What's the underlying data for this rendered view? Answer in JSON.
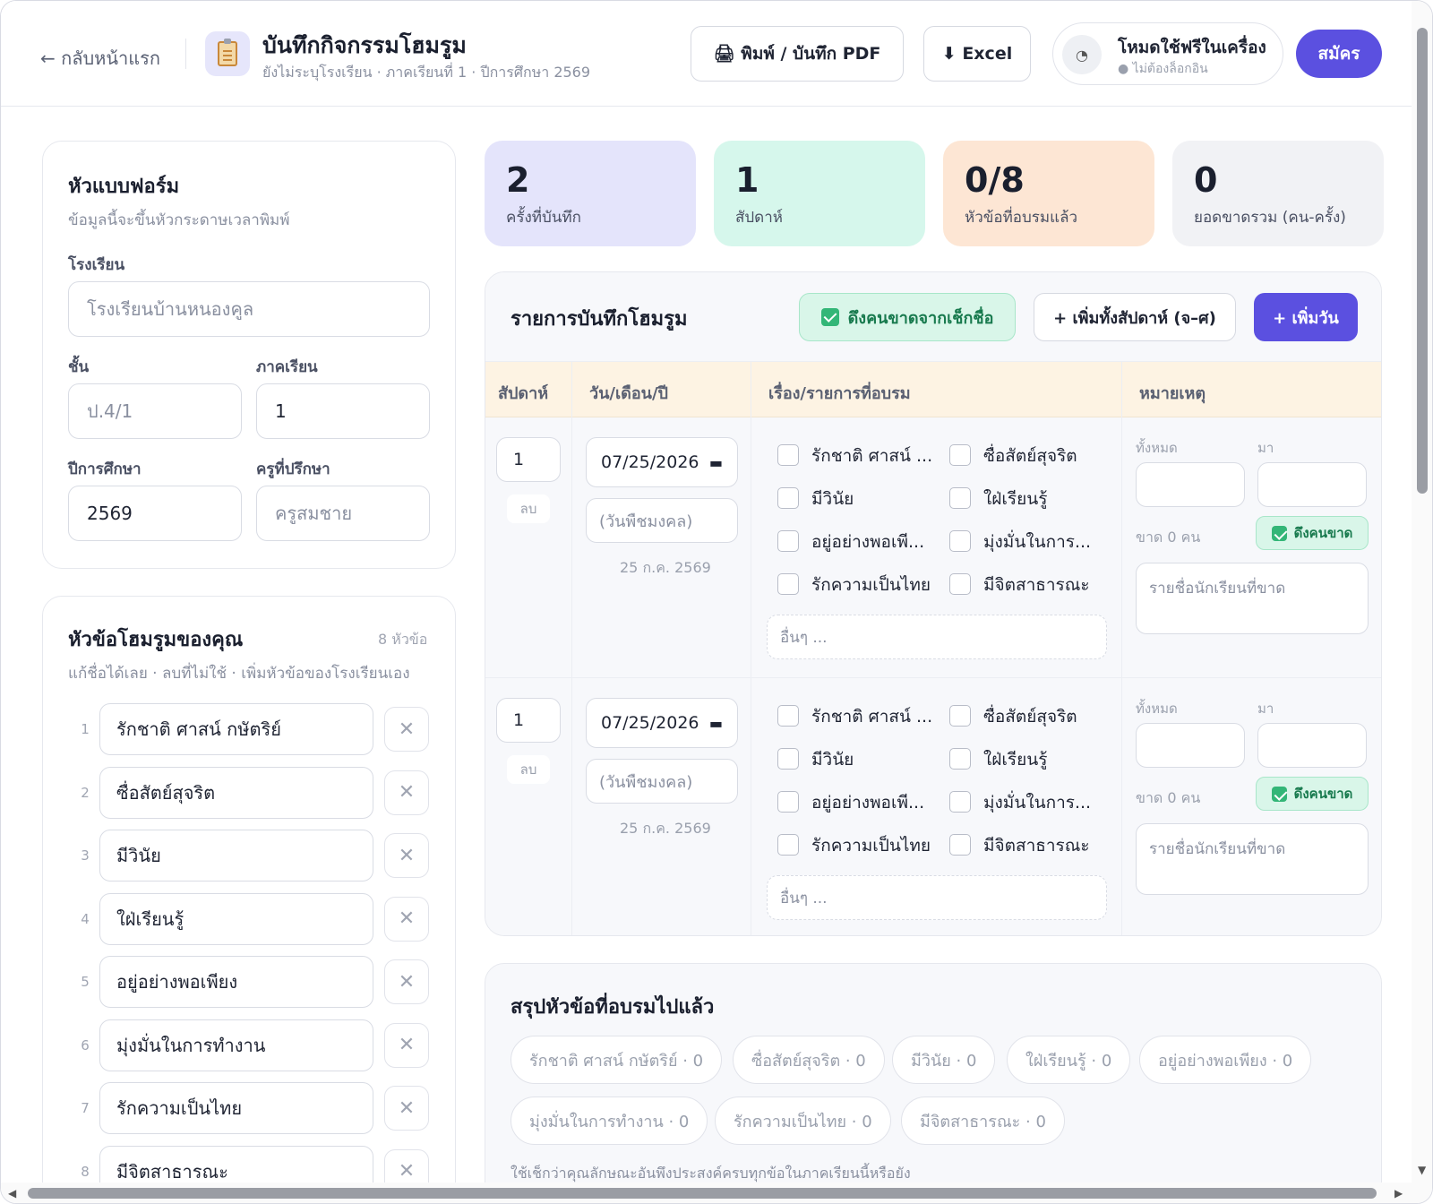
{
  "header": {
    "back_label": "← กลับหน้าแรก",
    "title": "บันทึกกิจกรรมโฮมรูม",
    "subtitle": "ยังไม่ระบุโรงเรียน · ภาคเรียนที่ 1 · ปีการศึกษา 2569",
    "print_label": "🖨 พิมพ์ / บันทึก PDF",
    "excel_label": "⬇ Excel",
    "mode_title": "โหมดใช้ฟรีในเครื่อง",
    "mode_sub": "● ไม่ต้องล็อกอิน",
    "signup_label": "สมัคร"
  },
  "form": {
    "title": "หัวแบบฟอร์ม",
    "desc": "ข้อมูลนี้จะขึ้นหัวกระดาษเวลาพิมพ์",
    "school_label": "โรงเรียน",
    "school_placeholder": "โรงเรียนบ้านหนองคูล",
    "class_label": "ชั้น",
    "class_placeholder": "ป.4/1",
    "term_label": "ภาคเรียน",
    "term_value": "1",
    "year_label": "ปีการศึกษา",
    "year_value": "2569",
    "teacher_label": "ครูที่ปรึกษา",
    "teacher_placeholder": "ครูสมชาย"
  },
  "topics": {
    "title": "หัวข้อโฮมรูมของคุณ",
    "count_label": "8 หัวข้อ",
    "desc": "แก้ชื่อได้เลย · ลบที่ไม่ใช้ · เพิ่มหัวข้อของโรงเรียนเอง",
    "items": [
      {
        "n": "1",
        "name": "รักชาติ ศาสน์ กษัตริย์"
      },
      {
        "n": "2",
        "name": "ซื่อสัตย์สุจริต"
      },
      {
        "n": "3",
        "name": "มีวินัย"
      },
      {
        "n": "4",
        "name": "ใฝ่เรียนรู้"
      },
      {
        "n": "5",
        "name": "อยู่อย่างพอเพียง"
      },
      {
        "n": "6",
        "name": "มุ่งมั่นในการทำงาน"
      },
      {
        "n": "7",
        "name": "รักความเป็นไทย"
      },
      {
        "n": "8",
        "name": "มีจิตสาธารณะ"
      }
    ]
  },
  "stats": [
    {
      "value": "2",
      "label": "ครั้งที่บันทึก",
      "color": "#e4e4fb"
    },
    {
      "value": "1",
      "label": "สัปดาห์",
      "color": "#d6f7ec"
    },
    {
      "value": "0/8",
      "label": "หัวข้อที่อบรมแล้ว",
      "color": "#fde6d4"
    },
    {
      "value": "0",
      "label": "ยอดขาดรวม (คน-ครั้ง)",
      "color": "#f1f2f5"
    }
  ],
  "records": {
    "title": "รายการบันทึกโฮมรูม",
    "pull_label": "ดึงคนขาดจากเช็กชื่อ",
    "add_week_label": "+ เพิ่มทั้งสัปดาห์ (จ–ศ)",
    "add_day_label": "+ เพิ่มวัน",
    "columns": [
      "สัปดาห์",
      "วัน/เดือน/ปี",
      "เรื่อง/รายการที่อบรม",
      "หมายเหตุ"
    ],
    "rows": [
      {
        "week": "1",
        "delete_label": "ลบ",
        "date": "07/25/2026",
        "day_name": "(วันพืชมงคล)",
        "thai_date": "25 ก.ค. 2569",
        "topics": [
          "รักชาติ ศาสน์ ...",
          "ซื่อสัตย์สุจริต",
          "มีวินัย",
          "ใฝ่เรียนรู้",
          "อยู่อย่างพอเพี...",
          "มุ่งมั่นในการ...",
          "รักความเป็นไทย",
          "มีจิตสาธารณะ"
        ],
        "other_placeholder": "อื่นๆ ...",
        "total_label": "ทั้งหมด",
        "present_label": "มา",
        "absent_label": "ขาด 0 คน",
        "pull_absent_label": "ดึงคนขาด",
        "absent_names_placeholder": "รายชื่อนักเรียนที่ขาด"
      },
      {
        "week": "1",
        "delete_label": "ลบ",
        "date": "07/25/2026",
        "day_name": "(วันพืชมงคล)",
        "thai_date": "25 ก.ค. 2569",
        "topics": [
          "รักชาติ ศาสน์ ...",
          "ซื่อสัตย์สุจริต",
          "มีวินัย",
          "ใฝ่เรียนรู้",
          "อยู่อย่างพอเพี...",
          "มุ่งมั่นในการ...",
          "รักความเป็นไทย",
          "มีจิตสาธารณะ"
        ],
        "other_placeholder": "อื่นๆ ...",
        "total_label": "ทั้งหมด",
        "present_label": "มา",
        "absent_label": "ขาด 0 คน",
        "pull_absent_label": "ดึงคนขาด",
        "absent_names_placeholder": "รายชื่อนักเรียนที่ขาด"
      }
    ]
  },
  "summary": {
    "title": "สรุปหัวข้อที่อบรมไปแล้ว",
    "chips": [
      "รักชาติ ศาสน์ กษัตริย์ · 0",
      "ซื่อสัตย์สุจริต · 0",
      "มีวินัย · 0",
      "ใฝ่เรียนรู้ · 0",
      "อยู่อย่างพอเพียง · 0",
      "มุ่งมั่นในการทำงาน · 0",
      "รักความเป็นไทย · 0",
      "มีจิตสาธารณะ · 0"
    ],
    "note": "ใช้เช็กว่าคุณลักษณะอันพึงประสงค์ครบทุกข้อในภาคเรียนนี้หรือยัง"
  }
}
